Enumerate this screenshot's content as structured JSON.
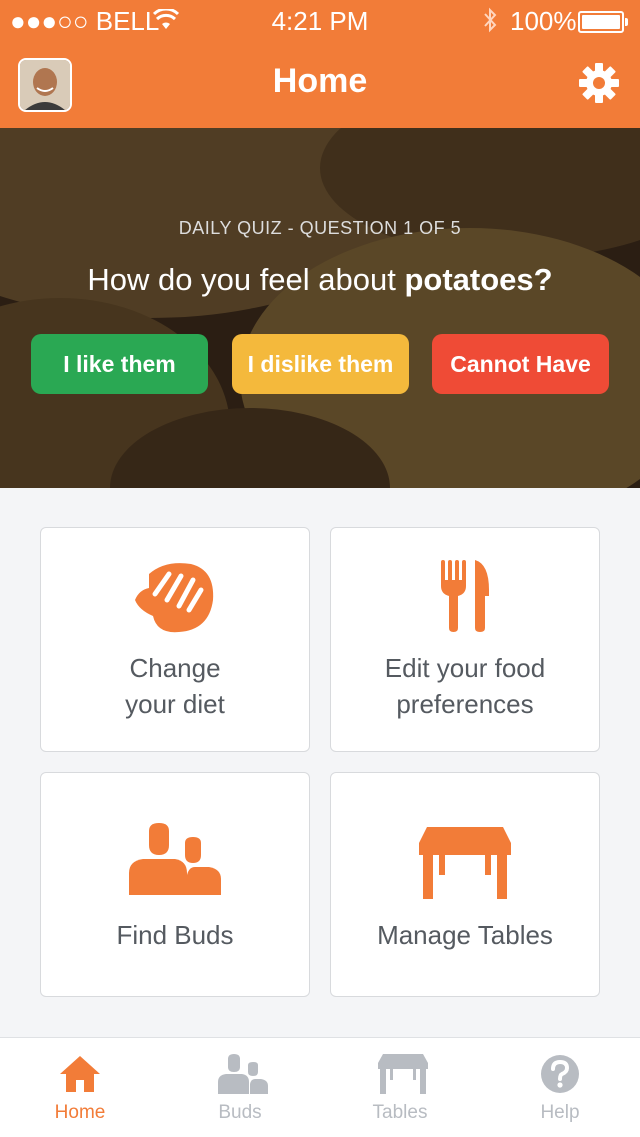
{
  "status_bar": {
    "carrier": "●●●○○ BELL",
    "time": "4:21 PM",
    "battery": "100%"
  },
  "header": {
    "title": "Home"
  },
  "quiz": {
    "label": "DAILY QUIZ - QUESTION 1 OF 5",
    "question_prefix": "How do you feel about ",
    "question_subject": "potatoes?",
    "answers": [
      {
        "label": "I like them",
        "color": "#2aa853"
      },
      {
        "label": "I dislike them",
        "color": "#f4b93c"
      },
      {
        "label": "Cannot Have",
        "color": "#ef4b36"
      }
    ]
  },
  "cards": [
    {
      "label_line1": "Change",
      "label_line2": "your diet",
      "icon": "steak-icon"
    },
    {
      "label_line1": "Edit your food",
      "label_line2": "preferences",
      "icon": "fork-knife-icon"
    },
    {
      "label_line1": "Find Buds",
      "icon": "people-icon"
    },
    {
      "label_line1": "Manage Tables",
      "icon": "table-icon"
    }
  ],
  "tabs": [
    {
      "label": "Home",
      "icon": "home-icon",
      "active": true
    },
    {
      "label": "Buds",
      "icon": "people-icon",
      "active": false
    },
    {
      "label": "Tables",
      "icon": "table-icon",
      "active": false
    },
    {
      "label": "Help",
      "icon": "question-icon",
      "active": false
    }
  ],
  "colors": {
    "accent": "#f27c38",
    "inactive_tab": "#b8bcc2"
  }
}
